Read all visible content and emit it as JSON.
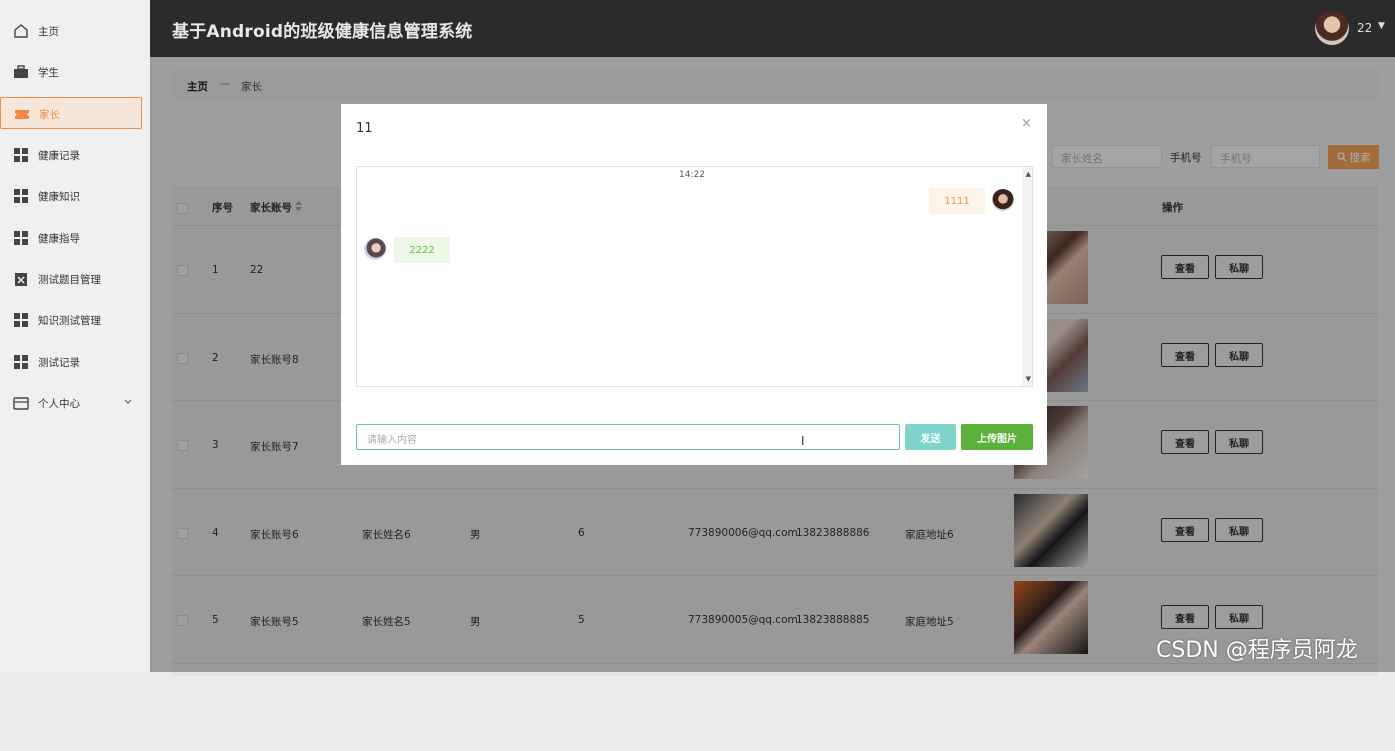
{
  "app": {
    "title": "基于Android的班级健康信息管理系统",
    "user": "22"
  },
  "sidebar": {
    "items": [
      {
        "label": "主页",
        "icon": "home-icon"
      },
      {
        "label": "学生",
        "icon": "briefcase-icon"
      },
      {
        "label": "家长",
        "icon": "ticket-icon",
        "active": true
      },
      {
        "label": "健康记录",
        "icon": "grid-icon"
      },
      {
        "label": "健康知识",
        "icon": "grid-icon"
      },
      {
        "label": "健康指导",
        "icon": "grid-icon"
      },
      {
        "label": "测试题目管理",
        "icon": "clipboard-icon"
      },
      {
        "label": "知识测试管理",
        "icon": "grid-icon"
      },
      {
        "label": "测试记录",
        "icon": "grid-icon"
      },
      {
        "label": "个人中心",
        "icon": "wallet-icon"
      }
    ]
  },
  "breadcrumb": {
    "home": "主页",
    "separator": "—",
    "current": "家长"
  },
  "search": {
    "name_placeholder": "家长姓名",
    "phone_label": "手机号",
    "phone_placeholder": "手机号",
    "button_label": "搜索"
  },
  "table": {
    "headers": {
      "index": "序号",
      "account": "家长账号",
      "action": "操作"
    },
    "rows": [
      {
        "index": "1",
        "account": "22",
        "name": "",
        "gender": "",
        "age": "",
        "email": "",
        "phone": "",
        "address": ""
      },
      {
        "index": "2",
        "account": "家长账号8",
        "name": "",
        "gender": "",
        "age": "",
        "email": "",
        "phone": "",
        "address": ""
      },
      {
        "index": "3",
        "account": "家长账号7",
        "name": "",
        "gender": "",
        "age": "",
        "email": "",
        "phone": "",
        "address": ""
      },
      {
        "index": "4",
        "account": "家长账号6",
        "name": "家长姓名6",
        "gender": "男",
        "age": "6",
        "email": "773890006@qq.com",
        "phone": "13823888886",
        "address": "家庭地址6"
      },
      {
        "index": "5",
        "account": "家长账号5",
        "name": "家长姓名5",
        "gender": "男",
        "age": "5",
        "email": "773890005@qq.com",
        "phone": "13823888885",
        "address": "家庭地址5"
      }
    ],
    "view_label": "查看",
    "chat_label": "私聊"
  },
  "modal": {
    "title": "11",
    "close": "×",
    "time": "14:22",
    "messages": {
      "mine": "1111",
      "other": "2222"
    },
    "input_placeholder": "请输入内容",
    "send_label": "发送",
    "upload_label": "上传图片"
  },
  "watermark": "CSDN @程序员阿龙",
  "colors": {
    "accent": "#f08a3c",
    "header_bg": "#2b2b2b",
    "send": "#7ed3cb",
    "upload": "#5ab23b"
  }
}
